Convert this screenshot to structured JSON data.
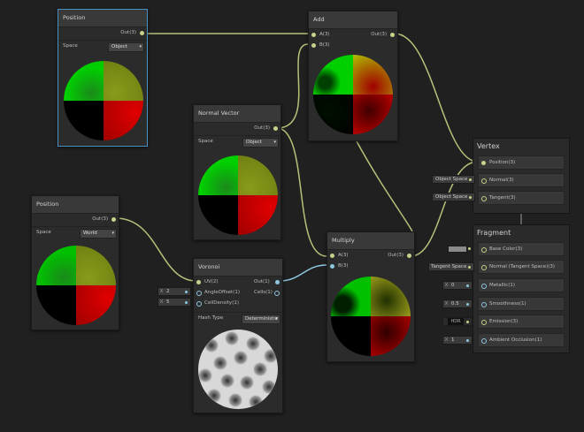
{
  "nodes": {
    "position1": {
      "title": "Position",
      "out": "Out(3)",
      "space_label": "Space",
      "space_value": "Object"
    },
    "add": {
      "title": "Add",
      "in_a": "A(3)",
      "in_b": "B(3)",
      "out": "Out(3)"
    },
    "normal_vector": {
      "title": "Normal Vector",
      "out": "Out(3)",
      "space_label": "Space",
      "space_value": "Object"
    },
    "position2": {
      "title": "Position",
      "out": "Out(3)",
      "space_label": "Space",
      "space_value": "World"
    },
    "voronoi": {
      "title": "Voronoi",
      "in_uv": "UV(2)",
      "in_angle": "AngleOffset(1)",
      "in_density": "CellDensity(1)",
      "out": "Out(1)",
      "cells": "Cells(1)",
      "hash_label": "Hash Type",
      "hash_value": "Deterministic",
      "angle_x": "X",
      "angle_value": "2",
      "density_x": "X",
      "density_value": "5"
    },
    "multiply": {
      "title": "Multiply",
      "in_a": "A(3)",
      "in_b": "B(3)",
      "out": "Out(3)"
    }
  },
  "vertex": {
    "title": "Vertex",
    "slots": [
      "Position(3)",
      "Normal(3)",
      "Tangent(3)"
    ],
    "normal_space": "Object Space",
    "tangent_space": "Object Space"
  },
  "fragment": {
    "title": "Fragment",
    "slots": [
      "Base Color(3)",
      "Normal (Tangent Space)(3)",
      "Metallic(1)",
      "Smoothness(1)",
      "Emission(3)",
      "Ambient Occlusion(1)"
    ],
    "normal_space": "Tangent Space",
    "metallic_x": "X",
    "metallic_value": "0",
    "smoothness_x": "X",
    "smoothness_value": "0.5",
    "emission_value": "HDR",
    "ao_x": "X",
    "ao_value": "1"
  },
  "colors": {
    "accent": "#4a90c0",
    "wire": "#c8d28a"
  }
}
